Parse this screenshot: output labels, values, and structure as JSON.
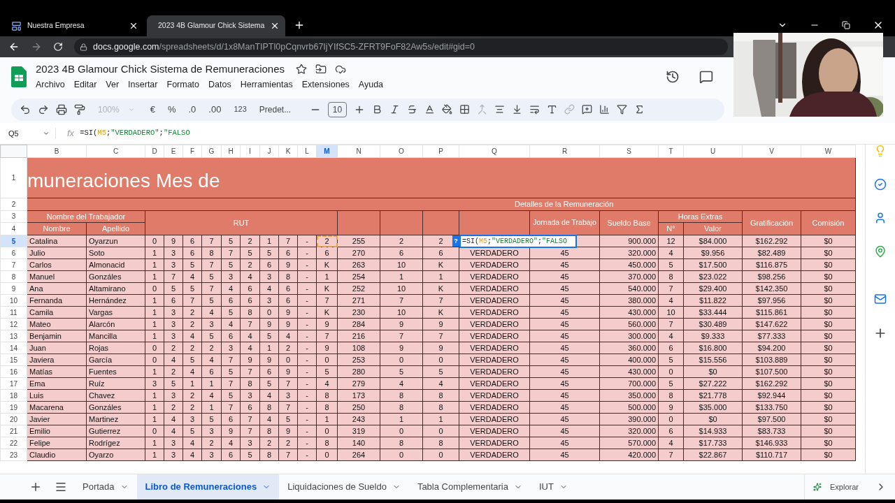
{
  "browser": {
    "tabs": [
      {
        "title": "Nuestra Empresa",
        "kind": "site",
        "selected": false
      },
      {
        "title": "2023 4B Glamour Chick Sistema",
        "kind": "sheets",
        "selected": true
      }
    ],
    "url": {
      "host": "docs.google.com",
      "path": "/spreadsheets/d/1x8ManTIPTl0pCqnvrb67IjYIfSC5-ZFRT9FoF82Aw5s/edit#gid=0"
    }
  },
  "doc": {
    "title": "2023 4B Glamour Chick Sistema de Remuneraciones",
    "menu": [
      "Archivo",
      "Editar",
      "Ver",
      "Insertar",
      "Formato",
      "Datos",
      "Herramientas",
      "Extensiones",
      "Ayuda"
    ]
  },
  "toolbar": {
    "zoom": "100%",
    "currency": "€",
    "percent": "%",
    "decrease_decimals": ".0",
    "increase_decimals": ".00",
    "number_format": "123",
    "font": "Predet...",
    "font_size": "10"
  },
  "formula_bar": {
    "cell_ref": "Q5",
    "fx": "fx",
    "formula": [
      {
        "text": "=SI(",
        "kind": "plain"
      },
      {
        "text": "M5",
        "kind": "ref"
      },
      {
        "text": ";",
        "kind": "plain"
      },
      {
        "text": "\"VERDADERO\"",
        "kind": "string"
      },
      {
        "text": ";",
        "kind": "plain"
      },
      {
        "text": "\"FALSO",
        "kind": "string"
      }
    ]
  },
  "sheet": {
    "columns": [
      {
        "letter": "B",
        "selected": false
      },
      {
        "letter": "C",
        "selected": false
      },
      {
        "letter": "D",
        "selected": false
      },
      {
        "letter": "E",
        "selected": false
      },
      {
        "letter": "F",
        "selected": false
      },
      {
        "letter": "G",
        "selected": false
      },
      {
        "letter": "H",
        "selected": false
      },
      {
        "letter": "I",
        "selected": false
      },
      {
        "letter": "J",
        "selected": false
      },
      {
        "letter": "K",
        "selected": false
      },
      {
        "letter": "L",
        "selected": false
      },
      {
        "letter": "M",
        "selected": true
      },
      {
        "letter": "N",
        "selected": false
      },
      {
        "letter": "O",
        "selected": false
      },
      {
        "letter": "P",
        "selected": false
      },
      {
        "letter": "Q",
        "selected": false
      },
      {
        "letter": "R",
        "selected": false
      },
      {
        "letter": "S",
        "selected": false
      },
      {
        "letter": "T",
        "selected": false
      },
      {
        "letter": "U",
        "selected": false
      },
      {
        "letter": "V",
        "selected": false
      },
      {
        "letter": "W",
        "selected": false
      }
    ],
    "header_rows": [
      "1",
      "2",
      "3",
      "4"
    ],
    "banner": "muneraciones Mes de",
    "details_header": "Detalles de la Remuneración",
    "worker_header": "Nombre del Trabajador",
    "first_name": "Nombre",
    "last_name": "Apellido",
    "rut": "RUT",
    "workday": "Jornada de Trabajo",
    "base_salary": "Sueldo Base",
    "overtime": "Horas Extras",
    "overtime_count": "N°",
    "overtime_value": "Valor",
    "bonus": "Gratificación",
    "commission": "Comisión",
    "rows": [
      {
        "n": "5",
        "selected": true,
        "referenced": true,
        "editor_badge": "?",
        "editor": [
          {
            "text": "=SI(",
            "kind": "plain"
          },
          {
            "text": "M5",
            "kind": "ref"
          },
          {
            "text": ";",
            "kind": "plain"
          },
          {
            "text": "\"VERDADERO\"",
            "kind": "string"
          },
          {
            "text": ";",
            "kind": "plain"
          },
          {
            "text": "\"FALSO",
            "kind": "string"
          }
        ],
        "cells": [
          "Catalina",
          "Oyarzun",
          "0",
          "9",
          "6",
          "7",
          "5",
          "2",
          "1",
          "7",
          "-",
          "2",
          "255",
          "2",
          "2",
          null,
          null,
          "900.000",
          "12",
          "$84.000",
          "$162.292",
          "$0"
        ]
      },
      {
        "n": "6",
        "selected": false,
        "referenced": false,
        "cells": [
          "Julio",
          "Soto",
          "1",
          "3",
          "6",
          "8",
          "7",
          "5",
          "5",
          "6",
          "-",
          "6",
          "270",
          "6",
          "6",
          "VERDADERO",
          "45",
          "320.000",
          "4",
          "$9.956",
          "$82.489",
          "$0"
        ]
      },
      {
        "n": "7",
        "selected": false,
        "referenced": false,
        "cells": [
          "Carlos",
          "Almonacid",
          "1",
          "3",
          "5",
          "7",
          "5",
          "2",
          "6",
          "9",
          "-",
          "K",
          "263",
          "10",
          "K",
          "VERDADERO",
          "45",
          "450.000",
          "5",
          "$17.500",
          "$116.875",
          "$0"
        ]
      },
      {
        "n": "8",
        "selected": false,
        "referenced": false,
        "cells": [
          "Manuel",
          "Gonzáles",
          "1",
          "7",
          "4",
          "5",
          "3",
          "4",
          "3",
          "8",
          "-",
          "1",
          "254",
          "1",
          "1",
          "VERDADERO",
          "45",
          "370.000",
          "8",
          "$23.022",
          "$98.256",
          "$0"
        ]
      },
      {
        "n": "9",
        "selected": false,
        "referenced": false,
        "cells": [
          "Ana",
          "Altamirano",
          "0",
          "5",
          "5",
          "7",
          "4",
          "6",
          "4",
          "6",
          "-",
          "K",
          "252",
          "10",
          "K",
          "VERDADERO",
          "45",
          "540.000",
          "7",
          "$29.400",
          "$142.350",
          "$0"
        ]
      },
      {
        "n": "10",
        "selected": false,
        "referenced": false,
        "cells": [
          "Fernanda",
          "Hernández",
          "1",
          "6",
          "7",
          "5",
          "6",
          "6",
          "3",
          "6",
          "-",
          "7",
          "271",
          "7",
          "7",
          "VERDADERO",
          "45",
          "380.000",
          "4",
          "$11.822",
          "$97.956",
          "$0"
        ]
      },
      {
        "n": "11",
        "selected": false,
        "referenced": false,
        "cells": [
          "Camila",
          "Vargas",
          "1",
          "3",
          "2",
          "4",
          "5",
          "8",
          "0",
          "9",
          "-",
          "K",
          "230",
          "10",
          "K",
          "VERDADERO",
          "45",
          "430.000",
          "10",
          "$33.444",
          "$115.861",
          "$0"
        ]
      },
      {
        "n": "12",
        "selected": false,
        "referenced": false,
        "cells": [
          "Mateo",
          "Alarcón",
          "1",
          "3",
          "2",
          "3",
          "4",
          "7",
          "9",
          "9",
          "-",
          "9",
          "284",
          "9",
          "9",
          "VERDADERO",
          "45",
          "560.000",
          "7",
          "$30.489",
          "$147.622",
          "$0"
        ]
      },
      {
        "n": "13",
        "selected": false,
        "referenced": false,
        "cells": [
          "Benjamin",
          "Mancilla",
          "1",
          "3",
          "4",
          "5",
          "6",
          "4",
          "5",
          "4",
          "-",
          "7",
          "216",
          "7",
          "7",
          "VERDADERO",
          "45",
          "300.000",
          "4",
          "$9.333",
          "$77.333",
          "$0"
        ]
      },
      {
        "n": "14",
        "selected": false,
        "referenced": false,
        "cells": [
          "Juan",
          "Rojas",
          "0",
          "2",
          "2",
          "2",
          "3",
          "4",
          "1",
          "2",
          "-",
          "9",
          "108",
          "9",
          "9",
          "VERDADERO",
          "45",
          "360.000",
          "6",
          "$16.800",
          "$94.200",
          "$0"
        ]
      },
      {
        "n": "15",
        "selected": false,
        "referenced": false,
        "cells": [
          "Javiera",
          "García",
          "0",
          "4",
          "5",
          "4",
          "7",
          "9",
          "9",
          "0",
          "-",
          "0",
          "253",
          "0",
          "0",
          "VERDADERO",
          "45",
          "400.000",
          "5",
          "$15.556",
          "$103.889",
          "$0"
        ]
      },
      {
        "n": "16",
        "selected": false,
        "referenced": false,
        "cells": [
          "Matías",
          "Fuentes",
          "1",
          "2",
          "4",
          "6",
          "5",
          "7",
          "6",
          "9",
          "-",
          "5",
          "280",
          "5",
          "5",
          "VERDADERO",
          "45",
          "430.000",
          "0",
          "$0",
          "$107.500",
          "$0"
        ]
      },
      {
        "n": "17",
        "selected": false,
        "referenced": false,
        "cells": [
          "Ema",
          "Ruíz",
          "3",
          "5",
          "1",
          "1",
          "7",
          "8",
          "5",
          "7",
          "-",
          "4",
          "279",
          "4",
          "4",
          "VERDADERO",
          "45",
          "700.000",
          "5",
          "$27.222",
          "$162.292",
          "$0"
        ]
      },
      {
        "n": "18",
        "selected": false,
        "referenced": false,
        "cells": [
          "Luis",
          "Chavez",
          "1",
          "3",
          "2",
          "4",
          "5",
          "3",
          "4",
          "3",
          "-",
          "8",
          "173",
          "8",
          "8",
          "VERDADERO",
          "45",
          "350.000",
          "8",
          "$21.778",
          "$92.944",
          "$0"
        ]
      },
      {
        "n": "19",
        "selected": false,
        "referenced": false,
        "cells": [
          "Macarena",
          "Gonzáles",
          "1",
          "2",
          "2",
          "1",
          "7",
          "6",
          "8",
          "7",
          "-",
          "8",
          "250",
          "8",
          "8",
          "VERDADERO",
          "45",
          "500.000",
          "9",
          "$35.000",
          "$133.750",
          "$0"
        ]
      },
      {
        "n": "20",
        "selected": false,
        "referenced": false,
        "cells": [
          "Javier",
          "Martinez",
          "1",
          "4",
          "3",
          "5",
          "6",
          "7",
          "4",
          "5",
          "-",
          "1",
          "243",
          "1",
          "1",
          "VERDADERO",
          "45",
          "390.000",
          "0",
          "$0",
          "$97.500",
          "$0"
        ]
      },
      {
        "n": "21",
        "selected": false,
        "referenced": false,
        "cells": [
          "Emilio",
          "Gutierrez",
          "0",
          "4",
          "5",
          "3",
          "9",
          "7",
          "8",
          "9",
          "-",
          "0",
          "319",
          "0",
          "0",
          "VERDADERO",
          "45",
          "320.000",
          "6",
          "$14.933",
          "$83.733",
          "$0"
        ]
      },
      {
        "n": "22",
        "selected": false,
        "referenced": false,
        "cells": [
          "Felipe",
          "Rodrígez",
          "1",
          "3",
          "4",
          "2",
          "4",
          "3",
          "2",
          "2",
          "-",
          "8",
          "140",
          "8",
          "8",
          "VERDADERO",
          "45",
          "570.000",
          "4",
          "$17.733",
          "$146.933",
          "$0"
        ]
      },
      {
        "n": "23",
        "selected": false,
        "referenced": false,
        "cells": [
          "Claudio",
          "Oyarzo",
          "1",
          "3",
          "4",
          "3",
          "6",
          "5",
          "8",
          "7",
          "-",
          "0",
          "264",
          "0",
          "0",
          "VERDADERO",
          "45",
          "420.000",
          "7",
          "$22.867",
          "$110.717",
          "$0"
        ]
      }
    ]
  },
  "sheet_tabs": [
    {
      "label": "Portada",
      "selected": false
    },
    {
      "label": "Libro de Remuneraciones",
      "selected": true
    },
    {
      "label": "Liquidaciones de Sueldo",
      "selected": false
    },
    {
      "label": "Tabla Complementaria",
      "selected": false
    },
    {
      "label": "IUT",
      "selected": false
    }
  ],
  "explore": "Explorar"
}
